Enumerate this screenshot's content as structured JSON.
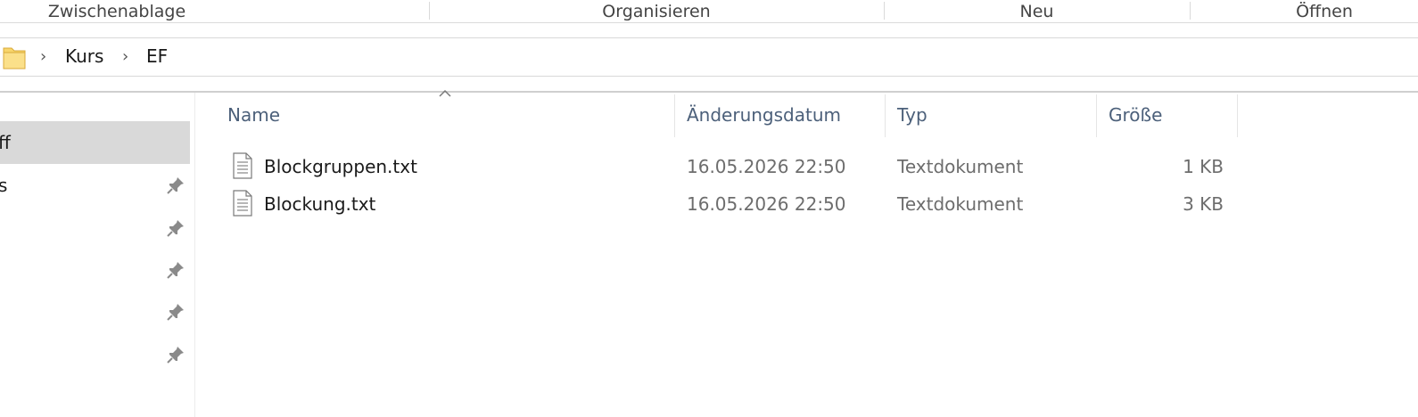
{
  "ribbon": {
    "groups": [
      "Zwischenablage",
      "Organisieren",
      "Neu",
      "Öffnen"
    ]
  },
  "address": {
    "crumbs": [
      "Kurs",
      "EF"
    ]
  },
  "nav": {
    "items": [
      {
        "label": "ff",
        "selected": true,
        "pinned": false
      },
      {
        "label": "s",
        "selected": false,
        "pinned": true
      },
      {
        "label": "",
        "selected": false,
        "pinned": true
      },
      {
        "label": "",
        "selected": false,
        "pinned": true
      },
      {
        "label": "",
        "selected": false,
        "pinned": true
      },
      {
        "label": "",
        "selected": false,
        "pinned": true
      }
    ]
  },
  "columns": {
    "name": "Name",
    "date": "Änderungsdatum",
    "type": "Typ",
    "size": "Größe",
    "sorted_column_icon": "sort-up-icon"
  },
  "files": [
    {
      "name": "Blockgruppen.txt",
      "date": "16.05.2026 22:50",
      "type": "Textdokument",
      "size": "1 KB",
      "icon": "text-file-icon"
    },
    {
      "name": "Blockung.txt",
      "date": "16.05.2026 22:50",
      "type": "Textdokument",
      "size": "3 KB",
      "icon": "text-file-icon"
    }
  ],
  "colors": {
    "header_text": "#4c607a",
    "selected_nav": "#d9d9d9",
    "folder_yellow": "#f8d56b"
  }
}
